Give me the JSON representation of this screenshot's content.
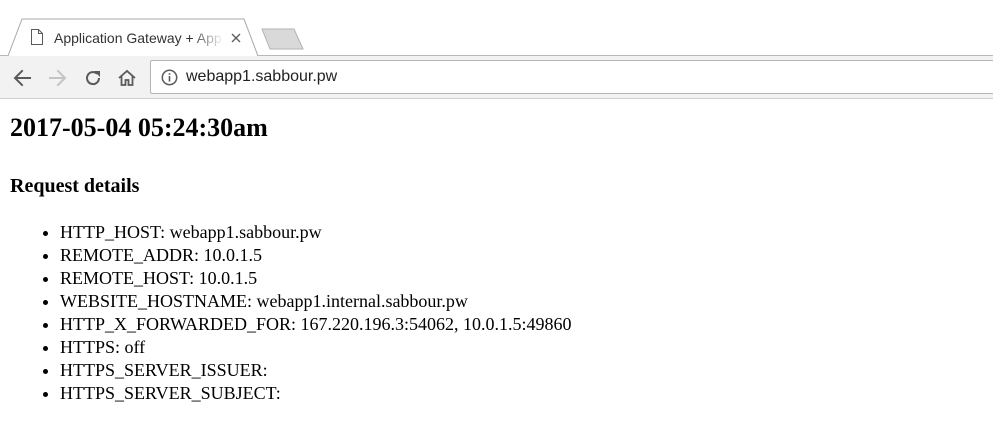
{
  "browser": {
    "tab_title": "Application Gateway + App Service",
    "url": "webapp1.sabbour.pw",
    "icons": {
      "favicon": "document-icon",
      "close": "close-icon",
      "back": "back-arrow-icon",
      "forward": "forward-arrow-icon",
      "reload": "reload-icon",
      "home": "home-icon",
      "info": "info-icon"
    },
    "colors": {
      "toolbar": "#f2f2f2",
      "tab_active": "#ffffff",
      "tab_inactive": "#d9d9d9"
    }
  },
  "page": {
    "title": "2017-05-04 05:24:30am",
    "section_heading": "Request details",
    "details": [
      "HTTP_HOST: webapp1.sabbour.pw",
      "REMOTE_ADDR: 10.0.1.5",
      "REMOTE_HOST: 10.0.1.5",
      "WEBSITE_HOSTNAME: webapp1.internal.sabbour.pw",
      "HTTP_X_FORWARDED_FOR: 167.220.196.3:54062, 10.0.1.5:49860",
      "HTTPS: off",
      "HTTPS_SERVER_ISSUER:",
      "HTTPS_SERVER_SUBJECT:"
    ]
  }
}
